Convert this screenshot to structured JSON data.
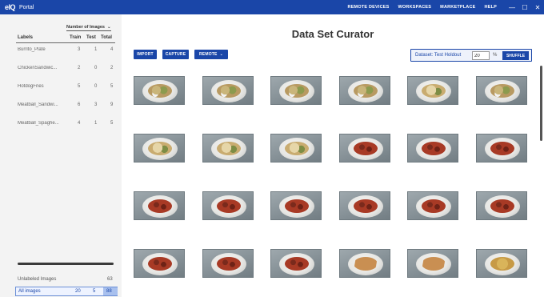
{
  "topbar": {
    "logo": "eIQ",
    "app_name": "Portal",
    "nav": [
      "REMOTE DEVICES",
      "WORKSPACES",
      "MARKETPLACE",
      "HELP"
    ],
    "window_controls": {
      "minimize": "—",
      "maximize": "☐",
      "close": "✕"
    }
  },
  "sidebar": {
    "group_header": "Number of Images",
    "columns": {
      "label": "Labels",
      "train": "Train",
      "test": "Test",
      "total": "Total"
    },
    "rows": [
      {
        "label": "Burrito_Plate",
        "train": "3",
        "test": "1",
        "total": "4"
      },
      {
        "label": "ChickenSandwic...",
        "train": "2",
        "test": "0",
        "total": "2"
      },
      {
        "label": "HotdogFries",
        "train": "5",
        "test": "0",
        "total": "5"
      },
      {
        "label": "Meatball_Sandwi...",
        "train": "6",
        "test": "3",
        "total": "9"
      },
      {
        "label": "Meatball_Spaghe...",
        "train": "4",
        "test": "1",
        "total": "5"
      }
    ],
    "unlabeled": {
      "label": "Unlabeled Images",
      "total": "63"
    },
    "all": {
      "label": "All images",
      "train": "20",
      "test": "5",
      "total": "88"
    }
  },
  "main": {
    "title": "Data Set Curator",
    "buttons": {
      "import": "IMPORT",
      "capture": "CAPTURE",
      "remote": "REMOTE"
    },
    "dataset": {
      "label": "Dataset: Test Holdout",
      "value": "20",
      "unit": "%",
      "shuffle": "SHUFFLE"
    }
  },
  "thumbnails": [
    "burrito",
    "burrito",
    "burrito",
    "burrito",
    "chicken",
    "burrito",
    "chicken",
    "chicken",
    "chicken",
    "meatball",
    "meatball",
    "meatball",
    "meatball",
    "meatball",
    "meatball",
    "meatball",
    "meatball",
    "meatball",
    "meatball",
    "meatball",
    "meatball",
    "hotdog",
    "hotdog",
    "fries"
  ],
  "colors": {
    "brand": "#1a46a8",
    "sidebar_bg": "#f3f3f3",
    "selection": "#a8c0ee"
  }
}
